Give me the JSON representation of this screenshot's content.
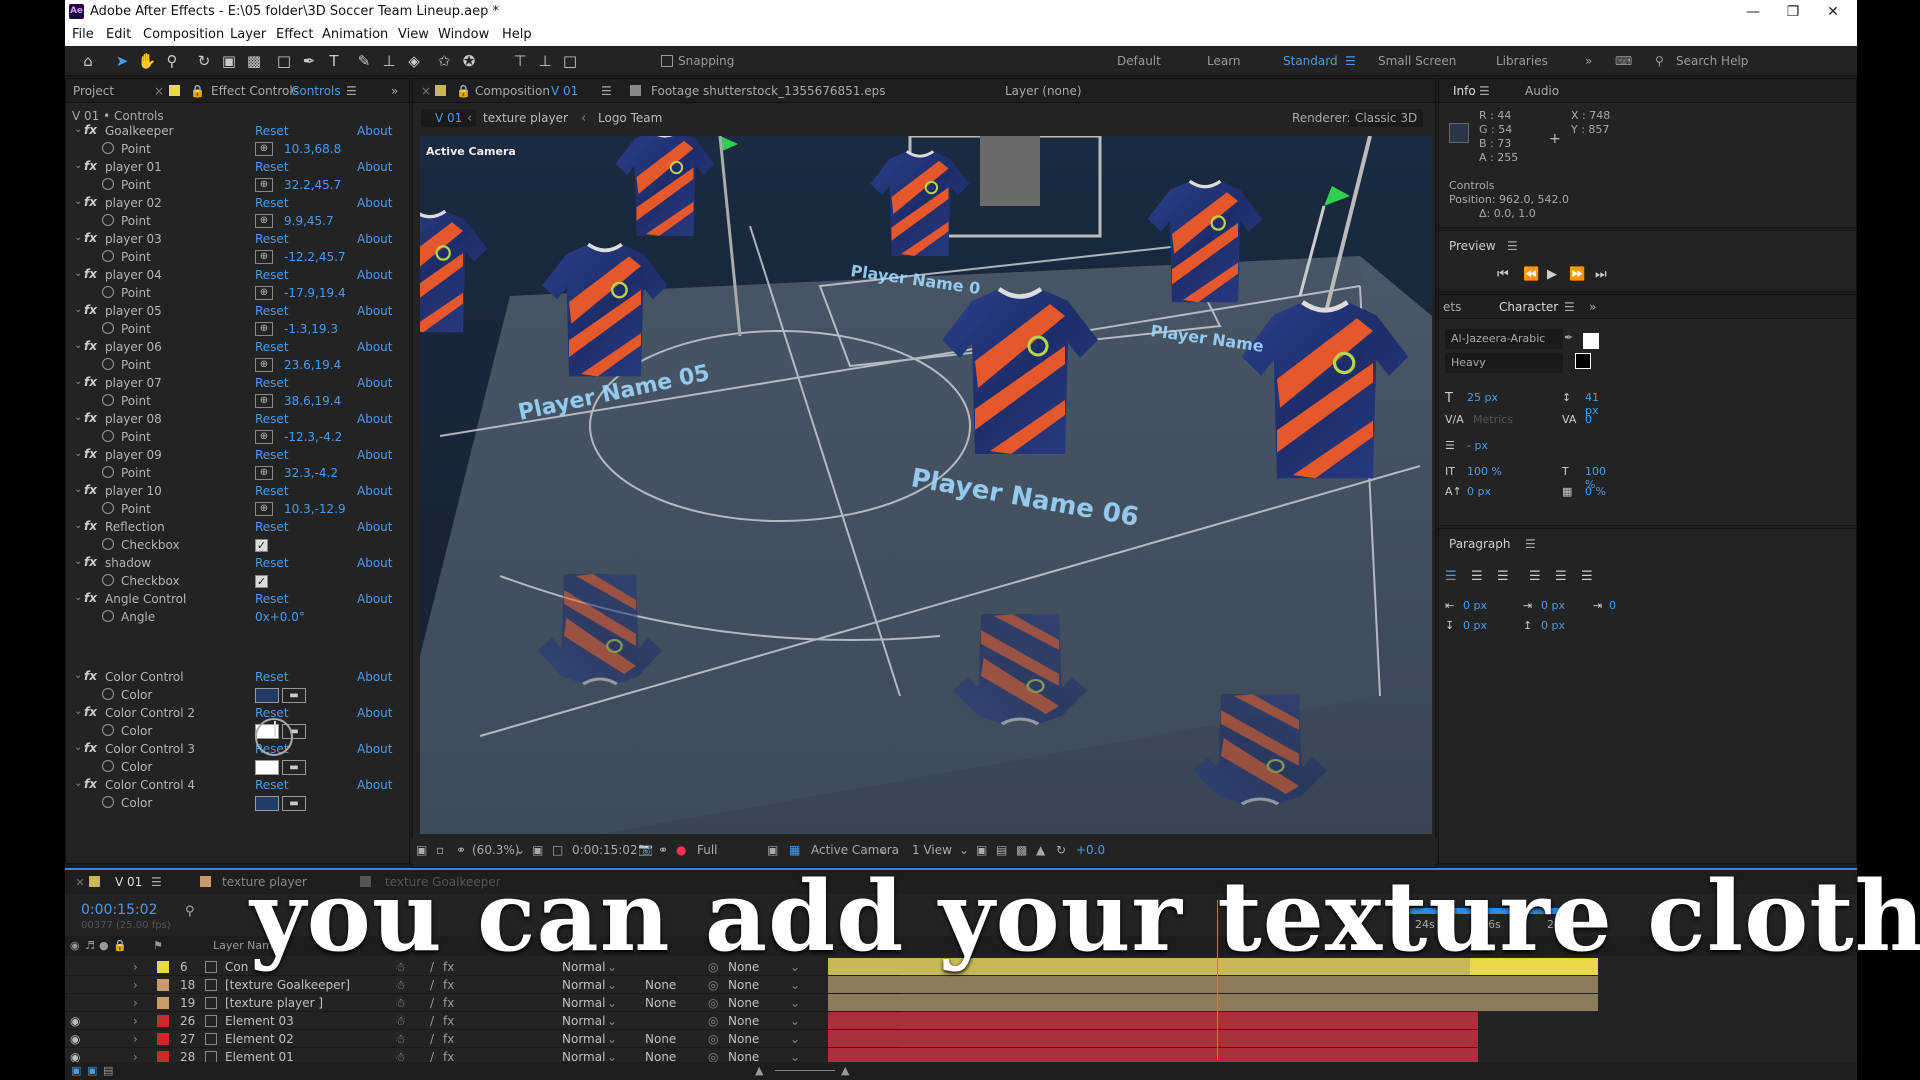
{
  "app": {
    "window_title": "Adobe After Effects - E:\\05 folder\\3D Soccer Team Lineup.aep *",
    "logo": "Ae",
    "window_controls": [
      "minimize-icon",
      "restore-icon",
      "close-icon"
    ]
  },
  "menu": [
    "File",
    "Edit",
    "Composition",
    "Layer",
    "Effect",
    "Animation",
    "View",
    "Window",
    "Help"
  ],
  "toolbar": {
    "snapping": "Snapping",
    "workspaces": [
      "Default",
      "Learn",
      "Standard",
      "Small Screen",
      "Libraries"
    ],
    "active_workspace": "Standard",
    "search_help": "Search Help",
    "tools": [
      "home-icon",
      "selection-icon",
      "hand-icon",
      "zoom-icon",
      "rotate-icon",
      "camera-icon",
      "pan-behind-icon",
      "rectangle-icon",
      "pen-icon",
      "type-icon",
      "brush-icon",
      "clone-stamp-icon",
      "eraser-icon",
      "roto-brush-icon",
      "puppet-icon"
    ]
  },
  "effect_controls": {
    "tab_project": "Project",
    "tab_effect": "Effect Controls",
    "tab_effect_name": "Controls",
    "header": "V 01 • Controls",
    "effects": [
      {
        "name": "Goalkeeper",
        "param": "Point",
        "value": "10.3,68.8",
        "kind": "point"
      },
      {
        "name": "player 01",
        "param": "Point",
        "value": "32.2,45.7",
        "kind": "point"
      },
      {
        "name": "player 02",
        "param": "Point",
        "value": "9.9,45.7",
        "kind": "point"
      },
      {
        "name": "player 03",
        "param": "Point",
        "value": "-12.2,45.7",
        "kind": "point"
      },
      {
        "name": "player 04",
        "param": "Point",
        "value": "-17.9,19.4",
        "kind": "point"
      },
      {
        "name": "player 05",
        "param": "Point",
        "value": "-1.3,19.3",
        "kind": "point"
      },
      {
        "name": "player 06",
        "param": "Point",
        "value": "23.6,19.4",
        "kind": "point"
      },
      {
        "name": "player 07",
        "param": "Point",
        "value": "38.6,19.4",
        "kind": "point"
      },
      {
        "name": "player 08",
        "param": "Point",
        "value": "-12.3,-4.2",
        "kind": "point"
      },
      {
        "name": "player 09",
        "param": "Point",
        "value": "32.3,-4.2",
        "kind": "point"
      },
      {
        "name": "player 10",
        "param": "Point",
        "value": "10.3,-12.9",
        "kind": "point"
      },
      {
        "name": "Reflection",
        "param": "Checkbox",
        "value": "✓",
        "kind": "check"
      },
      {
        "name": "shadow",
        "param": "Checkbox",
        "value": "✓",
        "kind": "check"
      },
      {
        "name": "Angle Control",
        "param": "Angle",
        "value": "0x+0.0°",
        "kind": "angle"
      },
      {
        "name": "Color Control",
        "param": "Color",
        "value": "",
        "kind": "color",
        "color": "#223a66"
      },
      {
        "name": "Color Control 2",
        "param": "Color",
        "value": "",
        "kind": "color",
        "color": "#ffffff"
      },
      {
        "name": "Color Control 3",
        "param": "Color",
        "value": "",
        "kind": "color",
        "color": "#ffffff"
      },
      {
        "name": "Color Control 4",
        "param": "Color",
        "value": "",
        "kind": "color",
        "color": "#223a66"
      }
    ],
    "reset": "Reset",
    "about": "About"
  },
  "composition": {
    "tab": "Composition",
    "tab_name": "V 01",
    "footage_tab": "Footage shutterstock_1355676851.eps",
    "layer_tab": "Layer (none)",
    "crumbs": [
      "V 01",
      "texture player",
      "Logo Team"
    ],
    "renderer_label": "Renderer:",
    "renderer": "Classic 3D",
    "active_camera_label": "Active Camera",
    "scene_labels": [
      "Player Name 05",
      "Player Name 06",
      "Player Name 0",
      "Player Name"
    ],
    "bottom_bar": {
      "zoom": "(60.3%)",
      "time": "0:00:15:02",
      "resolution": "Full",
      "camera": "Active Camera",
      "views": "1 View",
      "exposure": "+0.0"
    }
  },
  "info": {
    "tab": "Info",
    "tab2": "Audio",
    "R": "R : 44",
    "G": "G : 54",
    "B": "B : 73",
    "A": "A : 255",
    "X": "X : 748",
    "Y": "Y : 857",
    "layer": "Controls",
    "position": "Position: 962.0, 542.0",
    "delta": "Δ: 0.0, 1.0",
    "swatch": "#2c3649"
  },
  "preview": {
    "title": "Preview"
  },
  "character": {
    "tab_left": "ets",
    "tab": "Character",
    "font": "Al-Jazeera-Arabic",
    "style": "Heavy",
    "size": "25 px",
    "leading": "41 px",
    "kerning": "Metrics",
    "tracking": "0",
    "stroke": "- px",
    "vscale": "100 %",
    "hscale": "100 %",
    "baseline": "0 px",
    "tsume": "0 %"
  },
  "paragraph": {
    "title": "Paragraph",
    "indent_left": "0 px",
    "indent_first": "0 px",
    "indent_right": "0",
    "space_before": "0 px",
    "space_after": "0 px"
  },
  "timeline": {
    "tab_active": "V 01",
    "tab2": "texture player",
    "tab3": "texture Goalkeeper",
    "timecode": "0:00:15:02",
    "frames": "00377 (25.00 fps)",
    "col_layer_name": "Layer Name",
    "time_marks": [
      "24s",
      "26s",
      "28s"
    ],
    "layers": [
      {
        "num": "6",
        "name": "Con",
        "label": "#e8d84a",
        "mode": "Normal",
        "trk": "",
        "parent": "None",
        "bar": "#c9b85a",
        "hl": "#e8d84a"
      },
      {
        "num": "18",
        "name": "[texture Goalkeeper]",
        "label": "#c99a6a",
        "mode": "Normal",
        "trk": "None",
        "parent": "None",
        "bar": "#8c7c5c",
        "hl": ""
      },
      {
        "num": "19",
        "name": "[texture player ]",
        "label": "#c99a6a",
        "mode": "Normal",
        "trk": "None",
        "parent": "None",
        "bar": "#8c7c5c",
        "hl": ""
      },
      {
        "num": "26",
        "name": "Element 03",
        "label": "#cc2a2a",
        "mode": "Normal",
        "trk": "",
        "parent": "None",
        "bar": "#a8303a",
        "hl": ""
      },
      {
        "num": "27",
        "name": "Element 02",
        "label": "#cc2a2a",
        "mode": "Normal",
        "trk": "None",
        "parent": "None",
        "bar": "#a8303a",
        "hl": ""
      },
      {
        "num": "28",
        "name": "Element 01",
        "label": "#cc2a2a",
        "mode": "Normal",
        "trk": "None",
        "parent": "None",
        "bar": "#a8303a",
        "hl": ""
      }
    ]
  },
  "subtitle": "you can add your texture cloth"
}
